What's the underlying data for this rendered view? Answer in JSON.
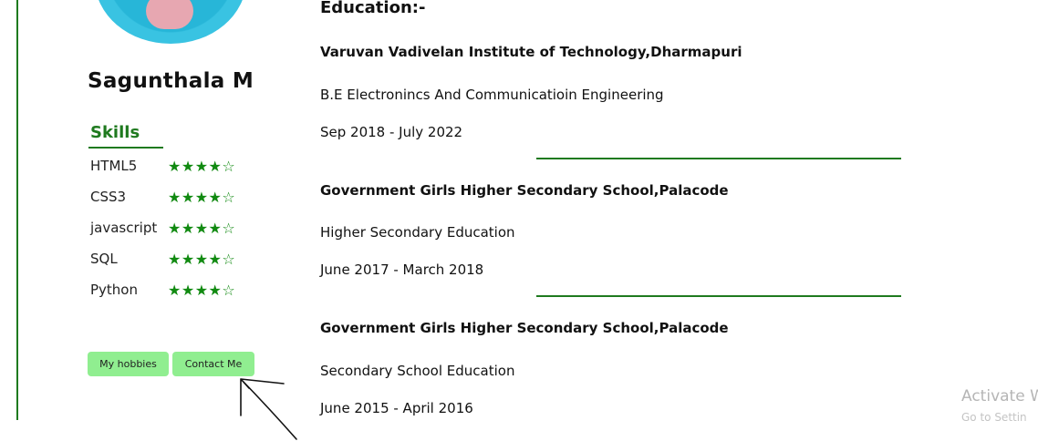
{
  "profile": {
    "name": "Sagunthala M"
  },
  "skills": {
    "title": "Skills",
    "items": [
      {
        "name": "HTML5",
        "stars": "★★★★☆",
        "rating": 4
      },
      {
        "name": "CSS3",
        "stars": "★★★★☆",
        "rating": 4
      },
      {
        "name": "javascript",
        "stars": "★★★★☆",
        "rating": 4
      },
      {
        "name": "SQL",
        "stars": "★★★★☆",
        "rating": 4
      },
      {
        "name": "Python",
        "stars": "★★★★☆",
        "rating": 4
      }
    ]
  },
  "buttons": {
    "hobbies": "My hobbies",
    "contact": "Contact Me"
  },
  "education": {
    "heading": "Education:-",
    "entries": [
      {
        "school": "Varuvan Vadivelan Institute of Technology,Dharmapuri",
        "degree": "B.E Electronincs And Communicatioin Engineering",
        "dates": "Sep 2018 - July 2022"
      },
      {
        "school": "Government Girls Higher Secondary School,Palacode",
        "degree": "Higher Secondary Education",
        "dates": "June 2017 - March 2018"
      },
      {
        "school": "Government Girls Higher Secondary School,Palacode",
        "degree": "Secondary School Education",
        "dates": "June 2015 - April 2016"
      }
    ]
  },
  "watermark": {
    "title": "Activate W",
    "sub": "Go to Settin"
  },
  "colors": {
    "accent": "#1f7a1f",
    "button_bg": "#90ee90",
    "star": "#118a11"
  }
}
